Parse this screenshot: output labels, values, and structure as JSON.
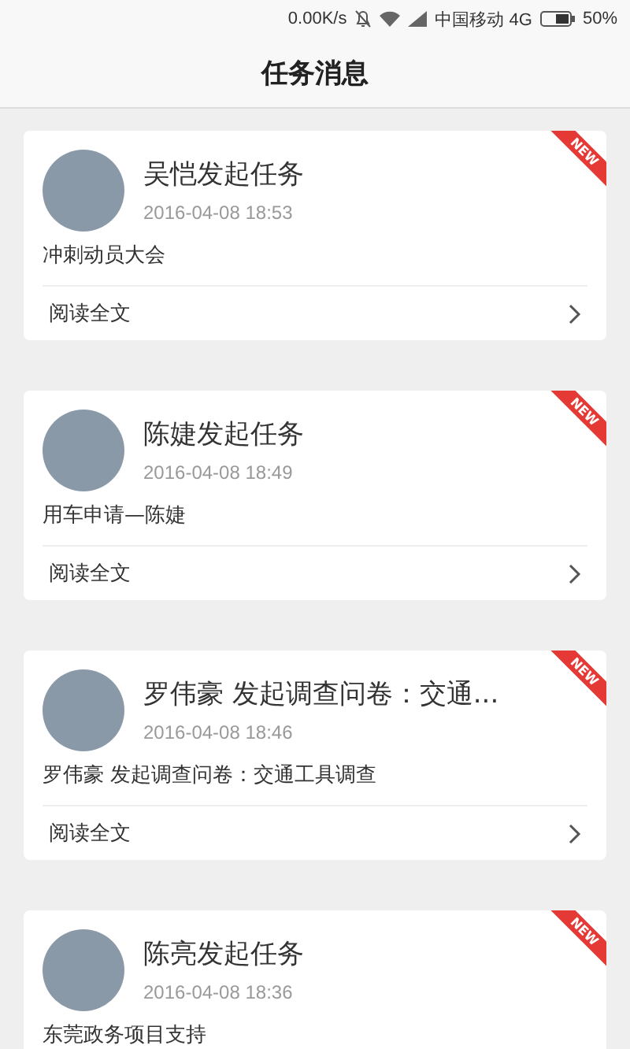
{
  "status_bar": {
    "speed": "0.00K/s",
    "carrier": "中国移动 4G",
    "battery": "50%"
  },
  "header": {
    "title": "任务消息"
  },
  "tasks": [
    {
      "title": "吴恺发起任务",
      "time": "2016-04-08 18:53",
      "body": "冲刺动员大会",
      "badge": "NEW",
      "read_more": "阅读全文"
    },
    {
      "title": "陈婕发起任务",
      "time": "2016-04-08 18:49",
      "body": "用车申请—陈婕",
      "badge": "NEW",
      "read_more": "阅读全文"
    },
    {
      "title": "罗伟豪 发起调查问卷：交通...",
      "time": "2016-04-08 18:46",
      "body": "罗伟豪 发起调查问卷：交通工具调查",
      "badge": "NEW",
      "read_more": "阅读全文"
    },
    {
      "title": "陈亮发起任务",
      "time": "2016-04-08 18:36",
      "body": "东莞政务项目支持",
      "badge": "NEW"
    }
  ]
}
